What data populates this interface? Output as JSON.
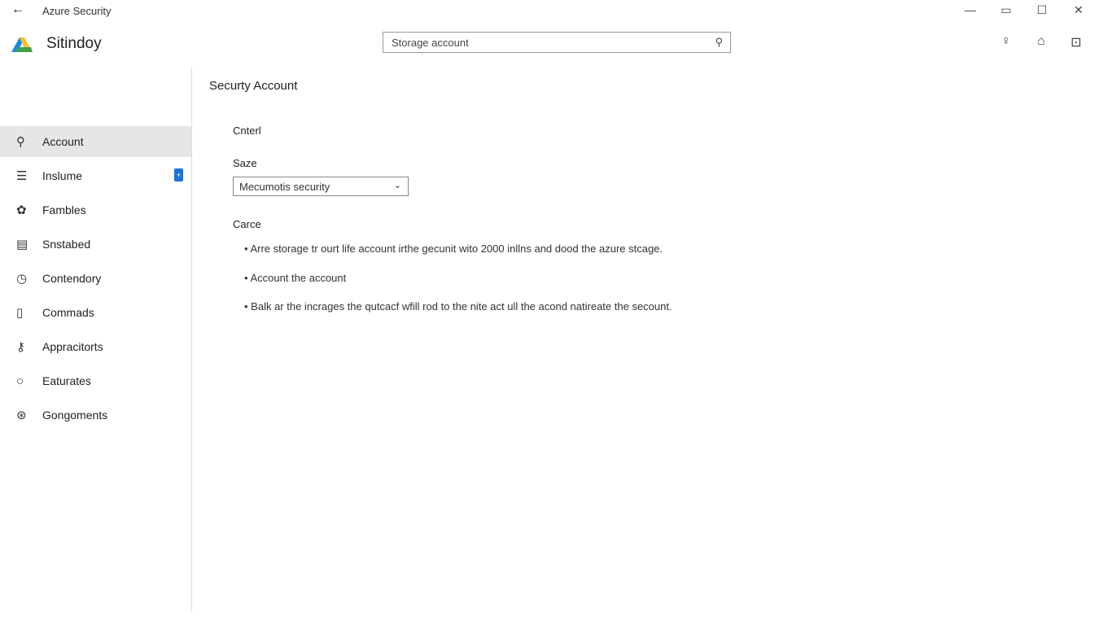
{
  "titlebar": {
    "title": "Azure Security"
  },
  "header": {
    "brand": "Sitindoy",
    "search_value": "Storage account"
  },
  "sidebar": {
    "items": [
      {
        "label": "Account",
        "icon": "search-icon",
        "active": true
      },
      {
        "label": "Inslume",
        "icon": "list-icon",
        "badge": "+"
      },
      {
        "label": "Fambles",
        "icon": "gear-icon"
      },
      {
        "label": "Snstabed",
        "icon": "table-icon"
      },
      {
        "label": "Contendory",
        "icon": "clock-icon"
      },
      {
        "label": "Commads",
        "icon": "document-icon"
      },
      {
        "label": "Appracitorts",
        "icon": "key-icon"
      },
      {
        "label": "Eaturates",
        "icon": "circle-icon"
      },
      {
        "label": "Gongoments",
        "icon": "settings-icon"
      }
    ]
  },
  "main": {
    "title": "Securty Account",
    "section1": "Cnterl",
    "field_label": "Saze",
    "select_value": "Mecumotis security",
    "section2": "Carce",
    "bullets": [
      "Arre storage tr ourt life account irthe gecunit wito 2000 inllns and dood the azure stcage.",
      "Account the account",
      "Balk ar the incrages the qutcacf wfill rod to the nite act ull the acond natireate the secount."
    ]
  },
  "colors": {
    "accent": "#1a73d9",
    "active_bg": "#e6e6e6"
  }
}
